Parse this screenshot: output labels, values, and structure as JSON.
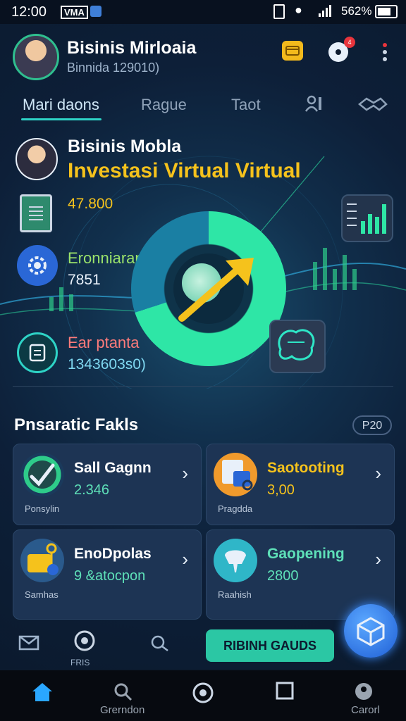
{
  "status_bar": {
    "time": "12:00",
    "carrier": "VMA",
    "battery_text": "562%",
    "icons": [
      "shield-icon",
      "sim-icon",
      "wifi-icon",
      "signal-icon",
      "battery-icon"
    ]
  },
  "header": {
    "name": "Bisinis Mirloaia",
    "subtitle": "Binnida 129010)",
    "notification_count": "4",
    "icons": [
      "wallet-icon",
      "bell-icon",
      "menu-dots-icon"
    ]
  },
  "tabs": [
    {
      "label": "Mari daons",
      "active": true
    },
    {
      "label": "Rague",
      "active": false
    },
    {
      "label": "Taot",
      "active": false
    }
  ],
  "hero": {
    "title": "Bisinis Mobla",
    "subtitle": "Investasi Virtual Virtual",
    "stats": [
      {
        "label": "",
        "value": "47.800",
        "icon": "document-icon"
      },
      {
        "label": "Eronniarang",
        "value": "7851",
        "icon": "gear-icon"
      },
      {
        "label": "Ear ptanta",
        "value": "1343603s0)",
        "icon": "clipboard-icon"
      }
    ]
  },
  "section": {
    "title": "Pnsaratic Fakls",
    "pill": "P20"
  },
  "cards": [
    {
      "title": "Sall Gagnn",
      "value": "2.346",
      "caption": "Ponsylin",
      "title_color": "#ffffff",
      "value_color": "#5ee0b8",
      "icon": "chart-check-icon"
    },
    {
      "title": "Saotooting",
      "value": "3,00",
      "caption": "Pragdda",
      "title_color": "#f5c21c",
      "value_color": "#f5c21c",
      "icon": "presentation-icon"
    },
    {
      "title": "EnoDpolas",
      "value": "9 &atocpon",
      "caption": "Samhas",
      "title_color": "#ffffff",
      "value_color": "#5ee0b8",
      "icon": "wallet-key-icon"
    },
    {
      "title": "Gaopening",
      "value": "2800",
      "caption": "Raahish",
      "title_color": "#5ee0b8",
      "value_color": "#5ee0b8",
      "icon": "plug-icon"
    }
  ],
  "action_bar": {
    "caption": "FRIS",
    "cta_label": "RIBINH GAUDS",
    "icons": [
      "mail-icon",
      "globe-icon",
      "search-refresh-icon"
    ]
  },
  "bottom_nav": [
    {
      "label": "",
      "icon": "home-icon",
      "active": true
    },
    {
      "label": "Grerndon",
      "icon": "search-icon",
      "active": false
    },
    {
      "label": "",
      "icon": "circle-icon",
      "active": false
    },
    {
      "label": "",
      "icon": "square-icon",
      "active": false
    },
    {
      "label": "Carorl",
      "icon": "profile-icon",
      "active": false
    }
  ],
  "colors": {
    "accent": "#2ed3c6",
    "gold": "#f5c21c",
    "background": "#0c1a2e",
    "card": "#1d3454"
  }
}
